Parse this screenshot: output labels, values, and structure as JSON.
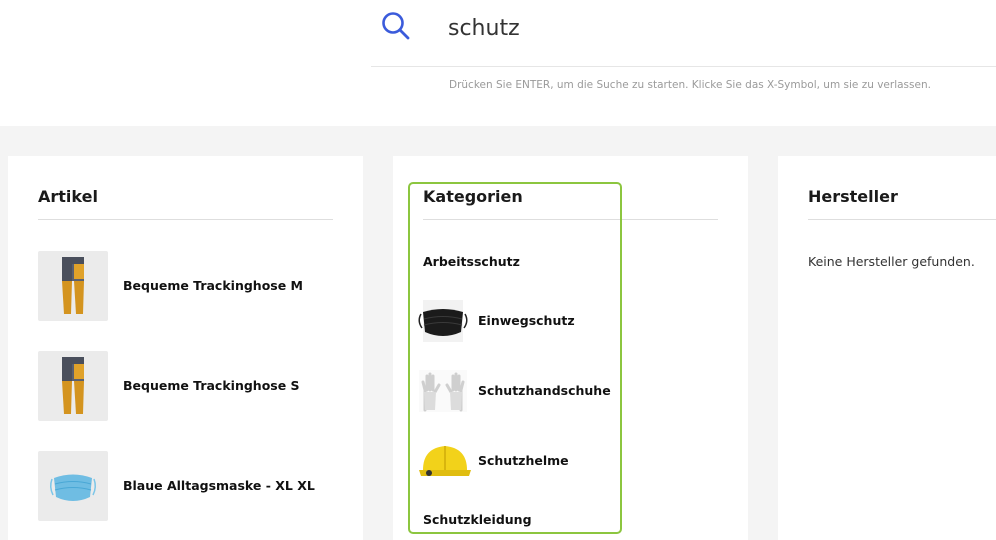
{
  "search": {
    "query": "schutz",
    "hint": "Drücken Sie ENTER, um die Suche zu starten. Klicke Sie das X-Symbol, um sie zu verlassen.",
    "icon": "search-icon",
    "accent_color": "#3b5bdb"
  },
  "articles": {
    "title": "Artikel",
    "items": [
      {
        "label": "Bequeme Trackinghose M",
        "icon": "pants-icon"
      },
      {
        "label": "Bequeme Trackinghose S",
        "icon": "pants-icon"
      },
      {
        "label": "Blaue Alltagsmaske - XL XL",
        "icon": "face-mask-icon"
      }
    ]
  },
  "categories": {
    "title": "Kategorien",
    "items": [
      {
        "label": "Arbeitsschutz"
      },
      {
        "label": "Einwegschutz",
        "icon": "black-mask-icon"
      },
      {
        "label": "Schutzhandschuhe",
        "icon": "gloves-icon"
      },
      {
        "label": "Schutzhelme",
        "icon": "helmet-icon"
      },
      {
        "label": "Schutzkleidung"
      }
    ],
    "highlight_color": "#8cc63f"
  },
  "manufacturers": {
    "title": "Hersteller",
    "empty_text": "Keine Hersteller gefunden."
  }
}
